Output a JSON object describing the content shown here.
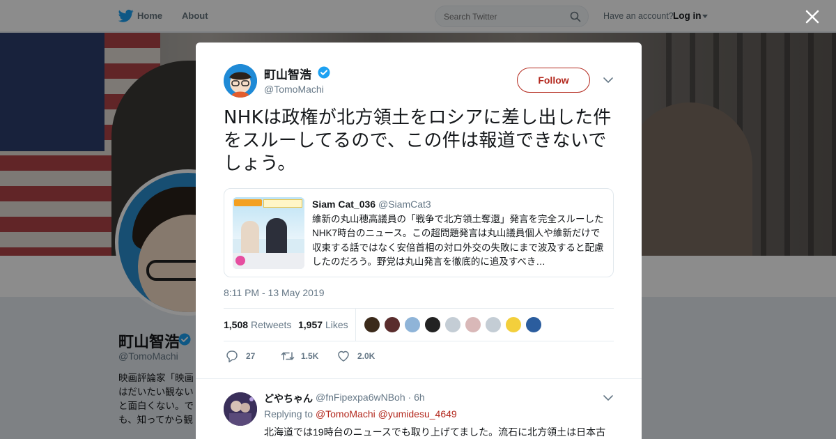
{
  "nav": {
    "home_label": "Home",
    "about_label": "About",
    "search_placeholder": "Search Twitter",
    "account_text": "Have an account?",
    "login_label": "Log in"
  },
  "profile": {
    "name": "町山智浩",
    "handle": "@TomoMachi",
    "bio": "映画評論家「映画はだいたい観ないと面白くない。でも、知ってから観ると倍面白い。観てからよく知ると何倍も面白い！」"
  },
  "tweet": {
    "author_name": "町山智浩",
    "author_handle": "@TomoMachi",
    "follow_label": "Follow",
    "text": "NHKは政権が北方領土をロシアに差し出した件をスルーしてるので、この件は報道できないでしょう。",
    "timestamp": "8:11 PM - 13 May 2019",
    "retweets_count": "1,508",
    "retweets_label": "Retweets",
    "likes_count": "1,957",
    "likes_label": "Likes",
    "actions": {
      "reply_count": "27",
      "retweet_count": "1.5K",
      "like_count": "2.0K"
    },
    "likers": [
      {
        "name": "liker-avatar",
        "color": "#3b2a1a"
      },
      {
        "name": "liker-avatar",
        "color": "#5a2d2d"
      },
      {
        "name": "liker-avatar",
        "color": "#8fb4d8"
      },
      {
        "name": "liker-avatar",
        "color": "#222222"
      },
      {
        "name": "liker-avatar",
        "color": "#c4cdd5"
      },
      {
        "name": "liker-avatar",
        "color": "#d9b8b8"
      },
      {
        "name": "liker-avatar",
        "color": "#c4cdd5"
      },
      {
        "name": "liker-avatar",
        "color": "#f3cf3c"
      },
      {
        "name": "liker-avatar",
        "color": "#2b5d9e"
      }
    ]
  },
  "quote": {
    "name": "Siam Cat_036",
    "handle": "@SiamCat3",
    "text": "維新の丸山穂高議員の「戦争で北方領土奪還」発言を完全スルーしたNHK7時台のニュース。この超問題発言は丸山議員個人や維新だけで収束する話ではなく安倍首相の対ロ外交の失敗にまで波及すると配慮したのだろう。野党は丸山発言を徹底的に追及すべき…"
  },
  "reply": {
    "name": "どやちゃん",
    "handle": "@fnFipexpa6wNBoh",
    "time": "· 6h",
    "replying_to_label": "Replying to",
    "mention1": "@TomoMachi",
    "mention2": "@yumidesu_4649",
    "text": "北海道では19時台のニュースでも取り上げてました。流石に北方領土は日本古"
  },
  "colors": {
    "accent": "#b3281d",
    "verified": "#1da1f2",
    "twitter_blue": "#1da1f2",
    "muted": "#657786"
  }
}
